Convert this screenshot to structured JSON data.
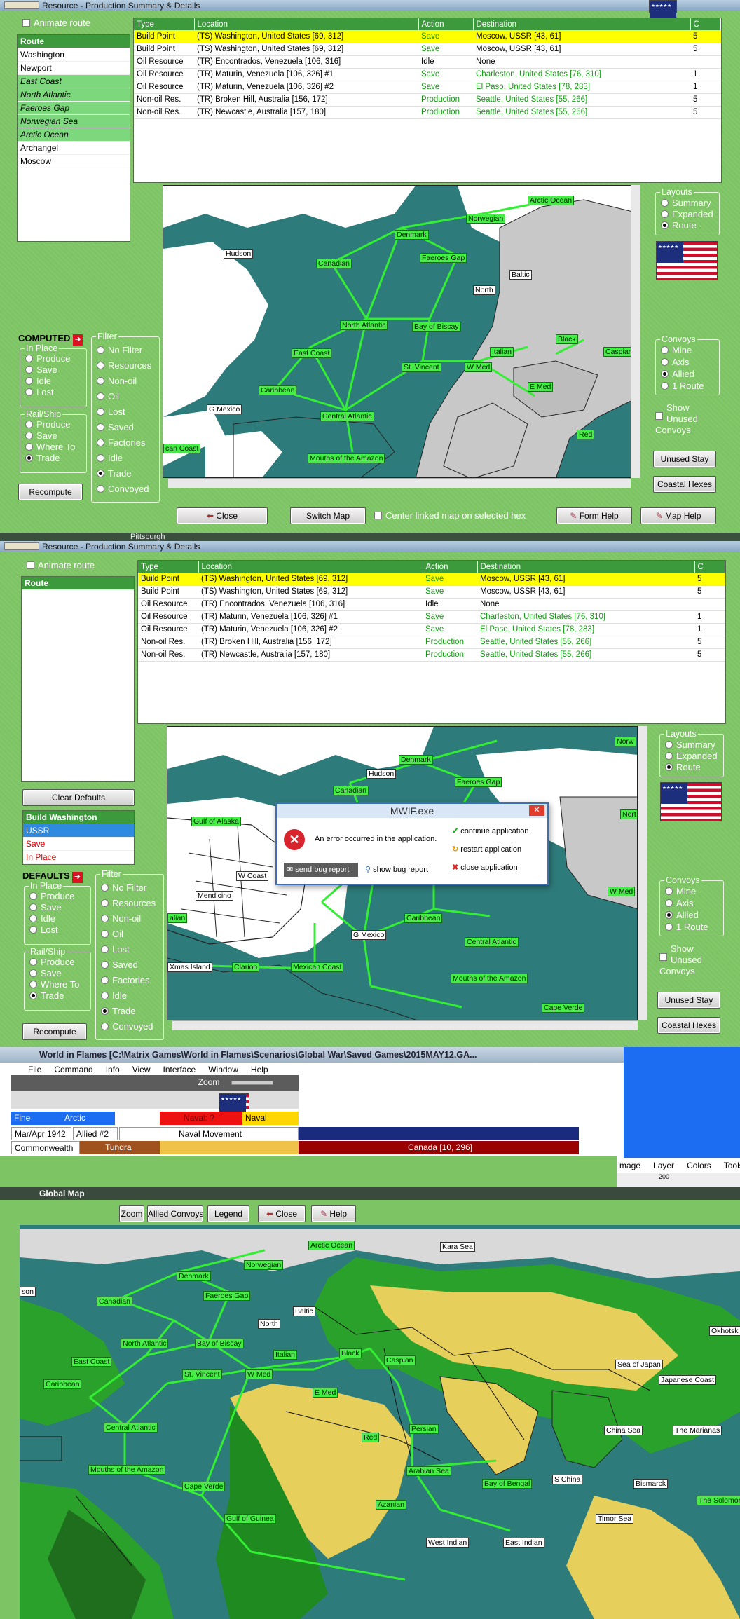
{
  "window1": {
    "title": "Resource - Production Summary & Details",
    "animate_route": "Animate route",
    "route_list": {
      "header": "Route",
      "items": [
        {
          "label": "Washington",
          "sea": false
        },
        {
          "label": "Newport",
          "sea": false
        },
        {
          "label": "East Coast",
          "sea": true
        },
        {
          "label": "North Atlantic",
          "sea": true
        },
        {
          "label": "Faeroes Gap",
          "sea": true
        },
        {
          "label": "Norwegian Sea",
          "sea": true
        },
        {
          "label": "Arctic Ocean",
          "sea": true
        },
        {
          "label": "Archangel",
          "sea": false
        },
        {
          "label": "Moscow",
          "sea": false
        }
      ]
    },
    "computed_label": "COMPUTED",
    "recompute": "Recompute",
    "close": "Close",
    "switch_map": "Switch Map",
    "center_linked": "Center linked map on selected hex",
    "form_help": "Form Help",
    "map_help": "Map Help",
    "unused_stay": "Unused Stay",
    "coastal_hexes": "Coastal Hexes",
    "layouts_selected": "Route",
    "below_text": "Pittsburgh"
  },
  "table": {
    "headers": [
      "Type",
      "Location",
      "Action",
      "Destination",
      "C"
    ],
    "rows": [
      {
        "type": "Build Point",
        "location": "(TS) Washington, United States [69, 312]",
        "action": "Save",
        "destination": "Moscow, USSR [43, 61]",
        "c": "5",
        "hl": true,
        "dgreen": false
      },
      {
        "type": "Build Point",
        "location": "(TS) Washington, United States [69, 312]",
        "action": "Save",
        "destination": "Moscow, USSR [43, 61]",
        "c": "5",
        "hl": false,
        "dgreen": false
      },
      {
        "type": "Oil Resource",
        "location": "(TR) Encontrados, Venezuela [106, 316]",
        "action": "Idle",
        "destination": "None",
        "c": "",
        "hl": false,
        "dgreen": false
      },
      {
        "type": "Oil Resource",
        "location": "(TR) Maturin, Venezuela [106, 326] #1",
        "action": "Save",
        "destination": "Charleston, United States [76, 310]",
        "c": "1",
        "hl": false,
        "dgreen": true
      },
      {
        "type": "Oil Resource",
        "location": "(TR) Maturin, Venezuela [106, 326] #2",
        "action": "Save",
        "destination": "El Paso, United States [78, 283]",
        "c": "1",
        "hl": false,
        "dgreen": true
      },
      {
        "type": "Non-oil Res.",
        "location": "(TR) Broken Hill, Australia [156, 172]",
        "action": "Production",
        "destination": "Seattle, United States [55, 266]",
        "c": "5",
        "hl": false,
        "dgreen": true
      },
      {
        "type": "Non-oil Res.",
        "location": "(TR) Newcastle, Australia [157, 180]",
        "action": "Production",
        "destination": "Seattle, United States [55, 266]",
        "c": "5",
        "hl": false,
        "dgreen": true
      }
    ]
  },
  "in_place": {
    "legend": "In Place",
    "options": [
      "Produce",
      "Save",
      "Idle",
      "Lost"
    ]
  },
  "rail_ship": {
    "legend": "Rail/Ship",
    "options": [
      "Produce",
      "Save",
      "Where To",
      "Trade"
    ],
    "selected": "Trade"
  },
  "filter": {
    "legend": "Filter",
    "options": [
      "No Filter",
      "Resources",
      "Non-oil",
      "Oil",
      "Lost",
      "Saved",
      "Factories",
      "Idle",
      "Trade",
      "Convoyed"
    ],
    "selected": "Trade"
  },
  "layouts": {
    "legend": "Layouts",
    "options": [
      "Summary",
      "Expanded",
      "Route"
    ]
  },
  "convoys": {
    "legend": "Convoys",
    "options": [
      "Mine",
      "Axis",
      "Allied",
      "1 Route"
    ],
    "selected": "Allied"
  },
  "show_unused": "Show Unused Convoys",
  "map_labels": {
    "arctic_ocean": "Arctic Ocean",
    "norwegian": "Norwegian",
    "denmark": "Denmark",
    "faeroes_gap": "Faeroes Gap",
    "canadian": "Canadian",
    "north_atlantic": "North Atlantic",
    "bay_of_biscay": "Bay of Biscay",
    "east_coast": "East Coast",
    "st_vincent": "St. Vincent",
    "w_med": "W Med",
    "italian": "Italian",
    "caribbean": "Caribbean",
    "central_atlantic": "Central Atlantic",
    "mouths_amazon": "Mouths of the Amazon",
    "black": "Black",
    "caspian": "Caspian",
    "e_med": "E Med",
    "red": "Red",
    "mexican_coast": "Mexican Coast",
    "hudson": "Hudson",
    "north": "North",
    "baltic": "Baltic",
    "g_mexico": "G Mexico",
    "gulf_of_alaska": "Gulf of Alaska",
    "w_coast": "W Coast",
    "mendicino": "Mendicino",
    "xmas_island": "Xmas Island",
    "clarion": "Clarion",
    "cape_verde": "Cape Verde",
    "kara_sea": "Kara Sea",
    "sea_of_japan": "Sea of Japan",
    "japanese_coast": "Japanese Coast",
    "okhotsk": "Okhotsk",
    "persian": "Persian",
    "arabian_sea": "Arabian Sea",
    "bay_of_bengal": "Bay of Bengal",
    "s_china": "S China",
    "china_sea": "China Sea",
    "the_marianas": "The Marianas",
    "bismarck": "Bismarck",
    "the_solomons": "The Solomons",
    "timor_sea": "Timor Sea",
    "west_indian": "West Indian",
    "east_indian": "East Indian",
    "gulf_of_guinea": "Gulf of Guinea",
    "azanian": "Azanian",
    "son": "son",
    "n_coast": "Nort",
    "norw_partial": "Norw",
    "caspian_partial": "Caspian",
    "coast_partial": "can Coast",
    "alian": "alian"
  },
  "window2": {
    "title": "Resource - Production Summary & Details",
    "animate_route": "Animate route",
    "route_header": "Route",
    "clear_defaults": "Clear Defaults",
    "build_header": "Build Washington",
    "build_items": [
      {
        "label": "USSR",
        "color": "#ffffff",
        "bg": "#2f8be0"
      },
      {
        "label": "Save",
        "color": "#dd0000",
        "bg": "#ffffff"
      },
      {
        "label": "In Place",
        "color": "#dd0000",
        "bg": "#ffffff"
      }
    ],
    "defaults_label": "DEFAULTS",
    "rail_selected": "Trade",
    "filter_selected": "Trade",
    "recompute": "Recompute"
  },
  "error_dialog": {
    "title": "MWIF.exe",
    "message": "An error occurred in the application.",
    "continue": "continue application",
    "restart": "restart application",
    "close_app": "close application",
    "send_bug": "send bug report",
    "show_bug": "show bug report"
  },
  "wif_window": {
    "title": "World in Flames [C:\\Matrix Games\\World in Flames\\Scenarios\\Global War\\Saved Games\\2015MAY12.GA...",
    "menu": [
      "File",
      "Command",
      "Info",
      "View",
      "Interface",
      "Window",
      "Help"
    ],
    "zoom": "Zoom",
    "fine": "Fine",
    "arctic": "Arctic",
    "naval_q": "Naval: ?",
    "naval": "Naval",
    "date": "Mar/Apr 1942",
    "allied_impulse": "Allied #2",
    "phase": "Naval Movement",
    "nation": "Commonwealth",
    "terrain": "Tundra",
    "hex": "Canada [10, 296]",
    "right_menu": [
      "mage",
      "Layer",
      "Colors",
      "Tools"
    ],
    "ruler": "200"
  },
  "global_map": {
    "title": "Global Map",
    "zoom": "Zoom",
    "allied_convoys": "Allied Convoys",
    "legend": "Legend",
    "close": "Close",
    "help": "Help"
  }
}
